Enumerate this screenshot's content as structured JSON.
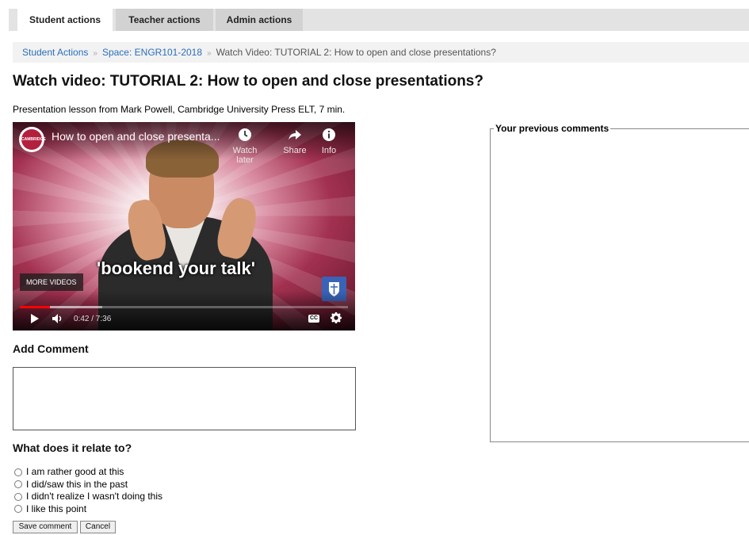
{
  "tabs": [
    {
      "label": "Student actions",
      "active": true
    },
    {
      "label": "Teacher actions",
      "active": false
    },
    {
      "label": "Admin actions",
      "active": false
    }
  ],
  "breadcrumb": {
    "items": [
      "Student Actions",
      "Space: ENGR101-2018"
    ],
    "current": "Watch Video: TUTORIAL 2: How to open and close presentations?",
    "separator": "»"
  },
  "page": {
    "title": "Watch video: TUTORIAL 2: How to open and close presentations?",
    "subtitle": "Presentation lesson from Mark Powell, Cambridge University Press ELT, 7 min."
  },
  "video": {
    "title": "How to open and close presenta...",
    "watch_later": "Watch later",
    "share": "Share",
    "info": "Info",
    "caption": "'bookend your talk'",
    "more_videos": "MORE VIDEOS",
    "time": "0:42 / 7:36",
    "cc": "CC",
    "channel_logo_text": "CAMBRIDGE",
    "progress": {
      "played_fraction": 0.092,
      "buffered_fraction": 0.25
    },
    "colors": {
      "progress": "#ff0000",
      "brand": "#b3203e"
    }
  },
  "comment": {
    "heading": "Add Comment",
    "value": ""
  },
  "relate": {
    "heading": "What does it relate to?",
    "options": [
      "I am rather good at this",
      "I did/saw this in the past",
      "I didn't realize I wasn't doing this",
      "I like this point"
    ]
  },
  "buttons": {
    "save": "Save comment",
    "cancel": "Cancel"
  },
  "previous_comments": {
    "legend": "Your previous comments"
  }
}
